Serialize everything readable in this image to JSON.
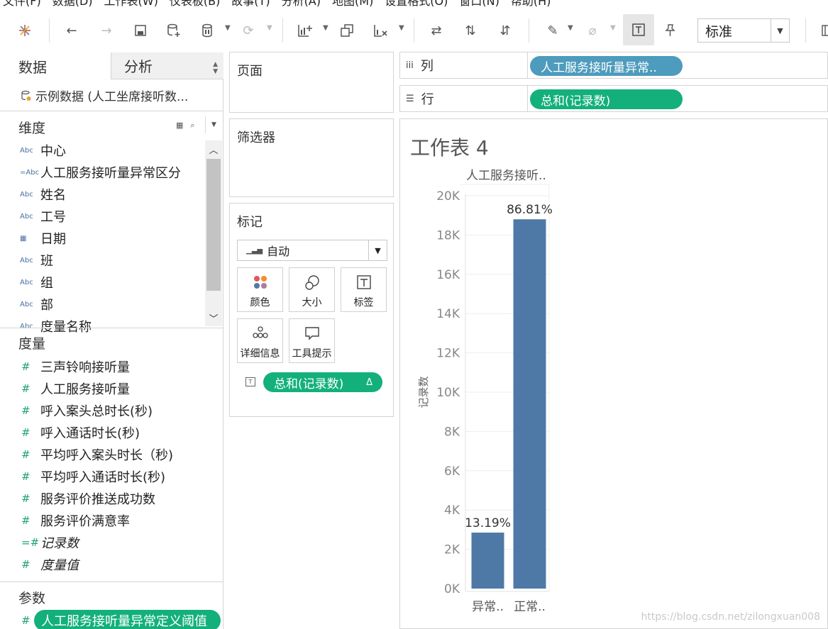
{
  "menu": [
    "文件(F)",
    "数据(D)",
    "工作表(W)",
    "仪表板(B)",
    "故事(T)",
    "分析(A)",
    "地图(M)",
    "设置格式(O)",
    "窗口(N)",
    "帮助(H)"
  ],
  "toolbar": {
    "fit_value": "标准",
    "icons": [
      "tableau-logo-icon",
      "back-icon",
      "forward-icon",
      "save-icon",
      "new-datasource-icon",
      "pause-updates-icon",
      "refresh-icon",
      "new-worksheet-icon",
      "duplicate-icon",
      "clear-icon",
      "swap-axes-icon",
      "sort-ascending-icon",
      "sort-descending-icon",
      "highlight-icon",
      "group-icon",
      "show-labels-icon",
      "pin-icon",
      "show-cards-icon"
    ]
  },
  "left": {
    "tab_data": "数据",
    "tab_analysis": "分析",
    "datasource": "示例数据 (人工坐席接听数...",
    "dimensions_title": "维度",
    "dimensions": [
      {
        "icon": "Abc",
        "label": "中心"
      },
      {
        "icon": "=Abc",
        "label": "人工服务接听量异常区分"
      },
      {
        "icon": "Abc",
        "label": "姓名"
      },
      {
        "icon": "Abc",
        "label": "工号"
      },
      {
        "icon": "date",
        "label": "日期"
      },
      {
        "icon": "Abc",
        "label": "班"
      },
      {
        "icon": "Abc",
        "label": "组"
      },
      {
        "icon": "Abc",
        "label": "部"
      },
      {
        "icon": "Abc",
        "label": "度量名称"
      }
    ],
    "measures_title": "度量",
    "measures": [
      {
        "icon": "#",
        "label": "三声铃响接听量",
        "italic": false
      },
      {
        "icon": "#",
        "label": "人工服务接听量",
        "italic": false
      },
      {
        "icon": "#",
        "label": "呼入案头总时长(秒)",
        "italic": false
      },
      {
        "icon": "#",
        "label": "呼入通话时长(秒)",
        "italic": false
      },
      {
        "icon": "#",
        "label": "平均呼入案头时长（秒)",
        "italic": false
      },
      {
        "icon": "#",
        "label": "平均呼入通话时长(秒)",
        "italic": false
      },
      {
        "icon": "#",
        "label": "服务评价推送成功数",
        "italic": false
      },
      {
        "icon": "#",
        "label": "服务评价满意率",
        "italic": false
      },
      {
        "icon": "=#",
        "label": "记录数",
        "italic": true
      },
      {
        "icon": "#",
        "label": "度量值",
        "italic": true
      }
    ],
    "params_title": "参数",
    "param_icon": "#",
    "param": "人工服务接听量异常定义阈值"
  },
  "cards": {
    "pages_title": "页面",
    "filters_title": "筛选器",
    "marks_title": "标记",
    "marks_type": "自动",
    "buttons": {
      "color": "颜色",
      "size": "大小",
      "label": "标签",
      "detail": "详细信息",
      "tooltip": "工具提示"
    },
    "marks_pill": "总和(记录数)",
    "marks_pill_delta": "Δ"
  },
  "shelves": {
    "columns_label": "列",
    "columns_pill": "人工服务接听量异常..",
    "rows_label": "行",
    "rows_pill": "总和(记录数)"
  },
  "viz": {
    "title": "工作表 4",
    "watermark": "https://blog.csdn.net/zilongxuan008"
  },
  "chart_data": {
    "type": "bar",
    "header": "人工服务接听..",
    "categories": [
      "异常..",
      "正常.."
    ],
    "values": [
      2850,
      18800
    ],
    "data_labels": [
      "13.19%",
      "86.81%"
    ],
    "ylabel": "记录数",
    "ylim": [
      0,
      20000
    ],
    "yticks": [
      0,
      2000,
      4000,
      6000,
      8000,
      10000,
      12000,
      14000,
      16000,
      18000,
      20000
    ],
    "ytick_labels": [
      "0K",
      "2K",
      "4K",
      "6K",
      "8K",
      "10K",
      "12K",
      "14K",
      "16K",
      "18K",
      "20K"
    ],
    "bar_color": "#4e79a7",
    "grid": true
  }
}
